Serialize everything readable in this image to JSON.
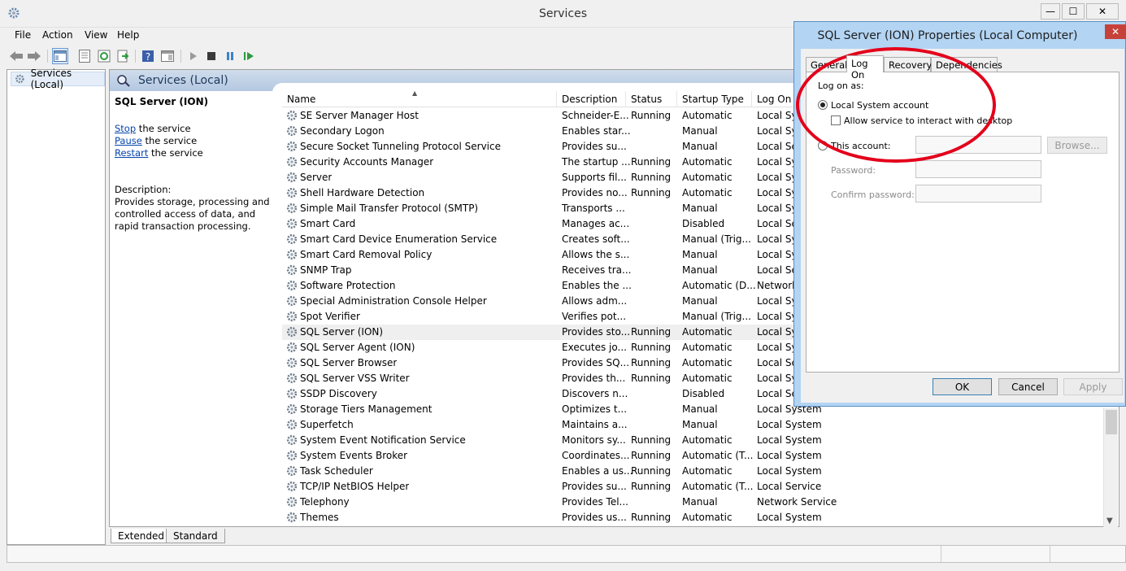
{
  "window": {
    "title": "Services",
    "controls": {
      "minimize": "—",
      "maximize": "☐",
      "close": "✕"
    }
  },
  "menu": [
    "File",
    "Action",
    "View",
    "Help"
  ],
  "tree": {
    "root_label": "Services (Local)"
  },
  "content": {
    "header_title": "Services (Local)",
    "selected_service": "SQL Server (ION)",
    "actions": [
      {
        "link": "Stop",
        "suffix": " the service"
      },
      {
        "link": "Pause",
        "suffix": " the service"
      },
      {
        "link": "Restart",
        "suffix": " the service"
      }
    ],
    "description_label": "Description:",
    "description_text": "Provides storage, processing and controlled access of data, and rapid transaction processing."
  },
  "columns": [
    "Name",
    "Description",
    "Status",
    "Startup Type",
    "Log On As"
  ],
  "columns_visible": [
    "Name",
    "Description",
    "Status",
    "Startup Type",
    "Log On"
  ],
  "services": [
    {
      "name": "SE Server Manager Host",
      "desc": "Schneider-E...",
      "status": "Running",
      "startup": "Automatic",
      "logon": "Local Sys"
    },
    {
      "name": "Secondary Logon",
      "desc": "Enables star...",
      "status": "",
      "startup": "Manual",
      "logon": "Local Sys"
    },
    {
      "name": "Secure Socket Tunneling Protocol Service",
      "desc": "Provides su...",
      "status": "",
      "startup": "Manual",
      "logon": "Local Ser"
    },
    {
      "name": "Security Accounts Manager",
      "desc": "The startup ...",
      "status": "Running",
      "startup": "Automatic",
      "logon": "Local Sys"
    },
    {
      "name": "Server",
      "desc": "Supports fil...",
      "status": "Running",
      "startup": "Automatic",
      "logon": "Local Sys"
    },
    {
      "name": "Shell Hardware Detection",
      "desc": "Provides no...",
      "status": "Running",
      "startup": "Automatic",
      "logon": "Local Sys"
    },
    {
      "name": "Simple Mail Transfer Protocol (SMTP)",
      "desc": "Transports ...",
      "status": "",
      "startup": "Manual",
      "logon": "Local Sys"
    },
    {
      "name": "Smart Card",
      "desc": "Manages ac...",
      "status": "",
      "startup": "Disabled",
      "logon": "Local Ser"
    },
    {
      "name": "Smart Card Device Enumeration Service",
      "desc": "Creates soft...",
      "status": "",
      "startup": "Manual (Trig...",
      "logon": "Local Sys"
    },
    {
      "name": "Smart Card Removal Policy",
      "desc": "Allows the s...",
      "status": "",
      "startup": "Manual",
      "logon": "Local Sys"
    },
    {
      "name": "SNMP Trap",
      "desc": "Receives tra...",
      "status": "",
      "startup": "Manual",
      "logon": "Local Ser"
    },
    {
      "name": "Software Protection",
      "desc": "Enables the ...",
      "status": "",
      "startup": "Automatic (D...",
      "logon": "Network"
    },
    {
      "name": "Special Administration Console Helper",
      "desc": "Allows adm...",
      "status": "",
      "startup": "Manual",
      "logon": "Local Sys"
    },
    {
      "name": "Spot Verifier",
      "desc": "Verifies pot...",
      "status": "",
      "startup": "Manual (Trig...",
      "logon": "Local Sys"
    },
    {
      "name": "SQL Server (ION)",
      "desc": "Provides sto...",
      "status": "Running",
      "startup": "Automatic",
      "logon": "Local Sys",
      "selected": true
    },
    {
      "name": "SQL Server Agent (ION)",
      "desc": "Executes jo...",
      "status": "Running",
      "startup": "Automatic",
      "logon": "Local Sys"
    },
    {
      "name": "SQL Server Browser",
      "desc": "Provides SQ...",
      "status": "Running",
      "startup": "Automatic",
      "logon": "Local Ser"
    },
    {
      "name": "SQL Server VSS Writer",
      "desc": "Provides th...",
      "status": "Running",
      "startup": "Automatic",
      "logon": "Local Sys"
    },
    {
      "name": "SSDP Discovery",
      "desc": "Discovers n...",
      "status": "",
      "startup": "Disabled",
      "logon": "Local Ser"
    },
    {
      "name": "Storage Tiers Management",
      "desc": "Optimizes t...",
      "status": "",
      "startup": "Manual",
      "logon": "Local System"
    },
    {
      "name": "Superfetch",
      "desc": "Maintains a...",
      "status": "",
      "startup": "Manual",
      "logon": "Local System"
    },
    {
      "name": "System Event Notification Service",
      "desc": "Monitors sy...",
      "status": "Running",
      "startup": "Automatic",
      "logon": "Local System"
    },
    {
      "name": "System Events Broker",
      "desc": "Coordinates...",
      "status": "Running",
      "startup": "Automatic (T...",
      "logon": "Local System"
    },
    {
      "name": "Task Scheduler",
      "desc": "Enables a us...",
      "status": "Running",
      "startup": "Automatic",
      "logon": "Local System"
    },
    {
      "name": "TCP/IP NetBIOS Helper",
      "desc": "Provides su...",
      "status": "Running",
      "startup": "Automatic (T...",
      "logon": "Local Service"
    },
    {
      "name": "Telephony",
      "desc": "Provides Tel...",
      "status": "",
      "startup": "Manual",
      "logon": "Network Service"
    },
    {
      "name": "Themes",
      "desc": "Provides us...",
      "status": "Running",
      "startup": "Automatic",
      "logon": "Local System"
    }
  ],
  "view_tabs": [
    "Extended",
    "Standard"
  ],
  "dialog": {
    "title": "SQL Server (ION) Properties (Local Computer)",
    "close": "✕",
    "tabs": [
      "General",
      "Log On",
      "Recovery",
      "Dependencies"
    ],
    "active_tab": "Log On",
    "logon_as_label": "Log on as:",
    "local_system_label": "Local System account",
    "interact_label": "Allow service to interact with desktop",
    "this_account_label": "This account:",
    "browse_label": "Browse...",
    "password_label": "Password:",
    "confirm_label": "Confirm password:",
    "ok": "OK",
    "cancel": "Cancel",
    "apply": "Apply"
  },
  "colors": {
    "annotation": "#e3001b",
    "header_band": "#b4c8e1",
    "dialog_frame": "#b3d4f3"
  }
}
